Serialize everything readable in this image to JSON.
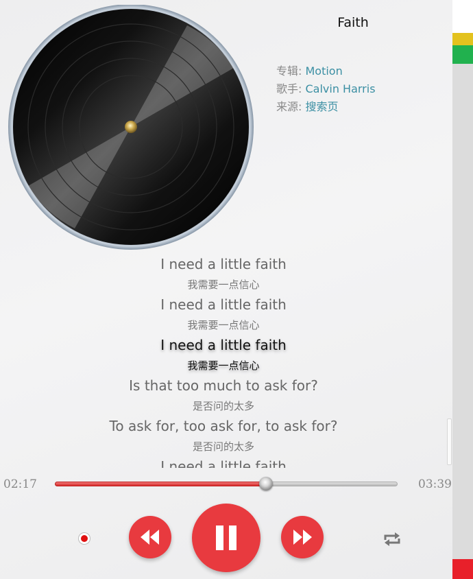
{
  "song": {
    "title": "Faith",
    "album_label": "专辑: ",
    "album": "Motion",
    "artist_label": "歌手: ",
    "artist": "Calvin Harris",
    "source_label": "来源: ",
    "source": "搜索页"
  },
  "lyrics": [
    {
      "en": "I need a little faith",
      "zh": "我需要一点信心",
      "current": false
    },
    {
      "en": "I need a little faith",
      "zh": "我需要一点信心",
      "current": false
    },
    {
      "en": "I need a little faith",
      "zh": "我需要一点信心",
      "current": true
    },
    {
      "en": "Is that too much to ask for?",
      "zh": "是否问的太多",
      "current": false
    },
    {
      "en": "To ask for, too ask for, to ask for?",
      "zh": "是否问的太多",
      "current": false
    },
    {
      "en": "I need a little faith",
      "zh": "",
      "current": false
    }
  ],
  "playback": {
    "current_time": "02:17",
    "total_time": "03:39",
    "progress": 0.615,
    "state": "playing"
  },
  "icons": {
    "record": "record-dot-icon",
    "prev": "rewind-icon",
    "pause": "pause-icon",
    "next": "fast-forward-icon",
    "repeat": "repeat-icon"
  },
  "colors": {
    "accent": "#e83a3f",
    "link": "#3b8fa3"
  }
}
